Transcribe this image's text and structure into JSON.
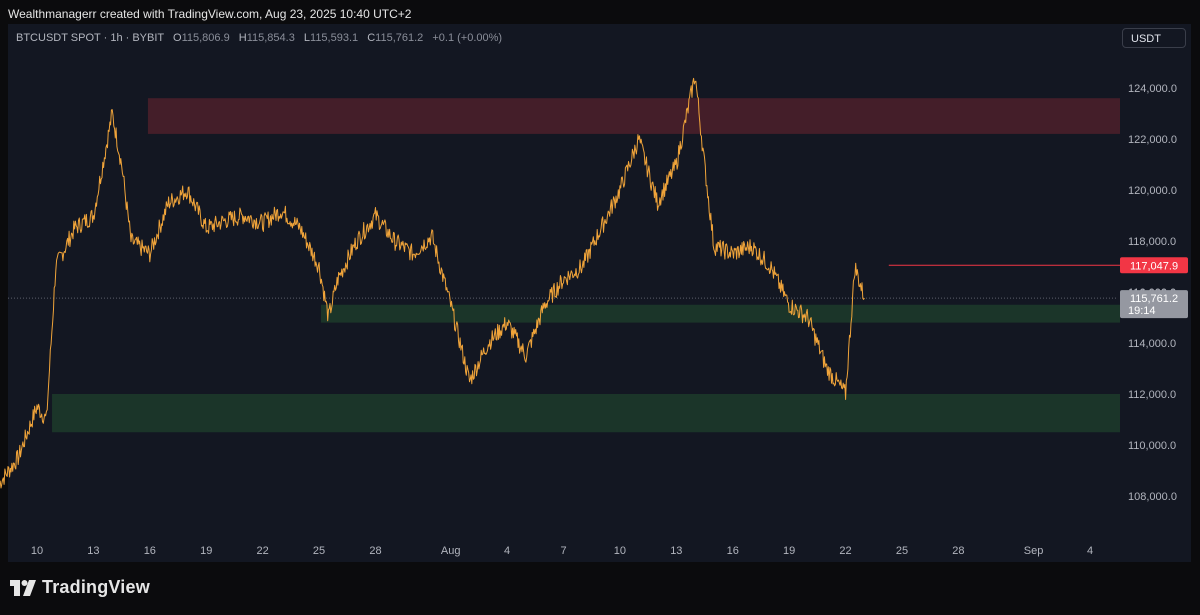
{
  "header": {
    "attribution": "Wealthmanagerr created with TradingView.com, Aug 23, 2025 10:40 UTC+2"
  },
  "legend": {
    "symbol": "BTCUSDT SPOT · 1h · BYBIT",
    "open_label": "O",
    "open_value": "115,806.9",
    "high_label": "H",
    "high_value": "115,854.3",
    "low_label": "L",
    "low_value": "115,593.1",
    "close_label": "C",
    "close_value": "115,761.2",
    "change": "+0.1 (+0.00%)"
  },
  "currency_button": "USDT",
  "footer": {
    "brand": "TradingView"
  },
  "colors": {
    "background": "#131722",
    "price_line": "#f0a43a",
    "resistance_zone": "#4a1f2a",
    "support_zone": "#1d3b2a",
    "resistance_line": "#f23645",
    "current_price_label": "#9598a1"
  },
  "chart_data": {
    "type": "line",
    "series": [
      {
        "values_hint": "hourly close prices approximated as waypoints",
        "x": [
          "Jul 8",
          "Jul 9",
          "Jul 10",
          "Jul 10",
          "Jul 11",
          "Jul 12",
          "Jul 13",
          "Jul 14",
          "Jul 14",
          "Jul 15",
          "Jul 16",
          "Jul 17",
          "Jul 18",
          "Jul 19",
          "Jul 20",
          "Jul 21",
          "Jul 22",
          "Jul 23",
          "Jul 24",
          "Jul 25",
          "Jul 25",
          "Jul 26",
          "Jul 27",
          "Jul 28",
          "Jul 29",
          "Jul 30",
          "Jul 31",
          "Aug 1",
          "Aug 2",
          "Aug 3",
          "Aug 4",
          "Aug 5",
          "Aug 6",
          "Aug 7",
          "Aug 8",
          "Aug 9",
          "Aug 10",
          "Aug 11",
          "Aug 12",
          "Aug 13",
          "Aug 14",
          "Aug 14",
          "Aug 15",
          "Aug 16",
          "Aug 17",
          "Aug 18",
          "Aug 19",
          "Aug 20",
          "Aug 21",
          "Aug 22",
          "Aug 22",
          "Aug 23"
        ],
        "y": [
          108500,
          109500,
          111500,
          111000,
          117000,
          118500,
          119000,
          123000,
          121000,
          118000,
          117500,
          119500,
          120000,
          118500,
          118800,
          119000,
          118700,
          119200,
          118500,
          117000,
          115000,
          116500,
          118000,
          119000,
          118000,
          117500,
          118200,
          115500,
          112500,
          114000,
          114800,
          113500,
          115500,
          116500,
          117000,
          118500,
          120000,
          122000,
          119500,
          121000,
          124500,
          121000,
          117800,
          117500,
          117800,
          117000,
          115500,
          115000,
          113000,
          112000,
          117000,
          115761
        ]
      }
    ],
    "zones": [
      {
        "kind": "resistance",
        "from": 122200,
        "to": 123600
      },
      {
        "kind": "support",
        "from": 114800,
        "to": 115500
      },
      {
        "kind": "support",
        "from": 110500,
        "to": 112000
      }
    ],
    "hlines": [
      {
        "value": 117047.9,
        "label": "117,047.9"
      }
    ],
    "current_price": {
      "value": 115761.2,
      "label": "115,761.2",
      "countdown": "19:14",
      "behind": "116,000.0"
    },
    "y_ticks": [
      "124,000.0",
      "122,000.0",
      "120,000.0",
      "118,000.0",
      "116,000.0",
      "114,000.0",
      "112,000.0",
      "110,000.0",
      "108,000.0"
    ],
    "y_tick_values": [
      124000,
      122000,
      120000,
      118000,
      116000,
      114000,
      112000,
      110000,
      108000
    ],
    "x_ticks": [
      "10",
      "13",
      "16",
      "19",
      "22",
      "25",
      "28",
      "Aug",
      "4",
      "7",
      "10",
      "13",
      "16",
      "19",
      "22",
      "25",
      "28",
      "Sep",
      "4"
    ],
    "x_tick_days": [
      2,
      5,
      8,
      11,
      14,
      17,
      20,
      24,
      27,
      30,
      33,
      36,
      39,
      42,
      45,
      48,
      51,
      55,
      58
    ],
    "ylim": [
      106000,
      125500
    ],
    "xlim_days": [
      0,
      60
    ],
    "grid": false,
    "title": "",
    "xlabel": "",
    "ylabel": ""
  }
}
